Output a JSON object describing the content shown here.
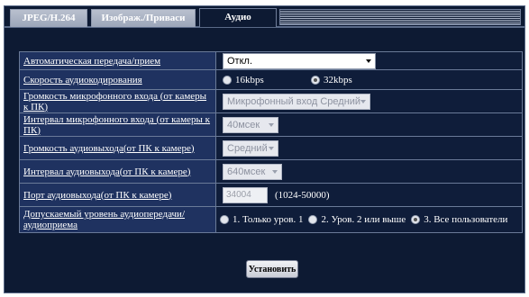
{
  "tabs": [
    {
      "label": "JPEG/H.264"
    },
    {
      "label": "Изображ./Приваси"
    },
    {
      "label": "Аудио"
    }
  ],
  "active_tab": "Аудио",
  "fields": {
    "auto_transfer": {
      "label": "Автоматическая передача/прием",
      "value": "Откл."
    },
    "encoding_speed": {
      "label": "Скорость аудиокодирования",
      "options": [
        "16kbps",
        "32kbps"
      ],
      "selected": "32kbps"
    },
    "mic_volume": {
      "label": "Громкость микрофонного входа (от камеры к ПК)",
      "value": "Микрофонный вход  Средний"
    },
    "mic_interval": {
      "label": "Интервал микрофонного входа (от камеры к ПК)",
      "value": "40мсек"
    },
    "out_volume": {
      "label": "Громкость аудиовыхода(от ПК к камере)",
      "value": "Средний"
    },
    "out_interval": {
      "label": "Интервал аудиовыхода(от ПК к камере)",
      "value": "640мсек"
    },
    "out_port": {
      "label": "Порт аудиовыхода(от ПК к камере)",
      "value": "34004",
      "range": "(1024-50000)"
    },
    "access_level": {
      "label": "Допускаемый уровень аудиопередачи/аудиоприема",
      "options": [
        "1. Только уров. 1",
        "2. Уров. 2 или выше",
        "3. Все пользователи"
      ],
      "selected": "3. Все пользователи"
    }
  },
  "apply_button": "Установить",
  "colors": {
    "panel": "#0d1a33",
    "label_bg": "#1f3260",
    "value_bg": "#0f1d3a"
  }
}
